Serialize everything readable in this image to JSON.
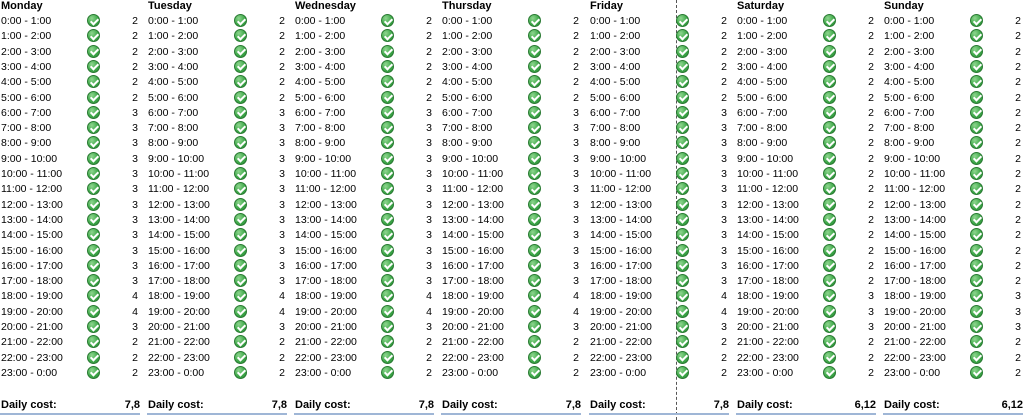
{
  "cost_label": "Daily cost:",
  "check_icon": "green-checkmark-icon",
  "days": [
    {
      "name": "Monday",
      "cost": "7,8",
      "values": [
        "2",
        "2",
        "2",
        "2",
        "2",
        "2",
        "3",
        "3",
        "3",
        "3",
        "3",
        "3",
        "3",
        "3",
        "3",
        "3",
        "3",
        "3",
        "4",
        "4",
        "3",
        "2",
        "2",
        "2"
      ]
    },
    {
      "name": "Tuesday",
      "cost": "7,8",
      "values": [
        "2",
        "2",
        "2",
        "2",
        "2",
        "2",
        "3",
        "3",
        "3",
        "3",
        "3",
        "3",
        "3",
        "3",
        "3",
        "3",
        "3",
        "3",
        "4",
        "4",
        "3",
        "2",
        "2",
        "2"
      ]
    },
    {
      "name": "Wednesday",
      "cost": "7,8",
      "values": [
        "2",
        "2",
        "2",
        "2",
        "2",
        "2",
        "3",
        "3",
        "3",
        "3",
        "3",
        "3",
        "3",
        "3",
        "3",
        "3",
        "3",
        "3",
        "4",
        "4",
        "3",
        "2",
        "2",
        "2"
      ]
    },
    {
      "name": "Thursday",
      "cost": "7,8",
      "values": [
        "2",
        "2",
        "2",
        "2",
        "2",
        "2",
        "3",
        "3",
        "3",
        "3",
        "3",
        "3",
        "3",
        "3",
        "3",
        "3",
        "3",
        "3",
        "4",
        "4",
        "3",
        "2",
        "2",
        "2"
      ]
    },
    {
      "name": "Friday",
      "cost": "7,8",
      "values": [
        "2",
        "2",
        "2",
        "2",
        "2",
        "2",
        "3",
        "3",
        "3",
        "3",
        "3",
        "3",
        "3",
        "3",
        "3",
        "3",
        "3",
        "3",
        "4",
        "4",
        "3",
        "2",
        "2",
        "2"
      ]
    },
    {
      "name": "Saturday",
      "cost": "6,12",
      "values": [
        "2",
        "2",
        "2",
        "2",
        "2",
        "2",
        "2",
        "2",
        "2",
        "2",
        "2",
        "2",
        "2",
        "2",
        "2",
        "2",
        "2",
        "2",
        "3",
        "3",
        "3",
        "2",
        "2",
        "2"
      ]
    },
    {
      "name": "Sunday",
      "cost": "6,12",
      "values": [
        "2",
        "2",
        "2",
        "2",
        "2",
        "2",
        "2",
        "2",
        "2",
        "2",
        "2",
        "2",
        "2",
        "2",
        "2",
        "2",
        "2",
        "2",
        "3",
        "3",
        "3",
        "2",
        "2",
        "2"
      ]
    }
  ],
  "slots": [
    "0:00 - 1:00",
    "1:00 - 2:00",
    "2:00 - 3:00",
    "3:00 - 4:00",
    "4:00 - 5:00",
    "5:00 - 6:00",
    "6:00 - 7:00",
    "7:00 - 8:00",
    "8:00 - 9:00",
    "9:00 - 10:00",
    "10:00 - 11:00",
    "11:00 - 12:00",
    "12:00 - 13:00",
    "13:00 - 14:00",
    "14:00 - 15:00",
    "15:00 - 16:00",
    "16:00 - 17:00",
    "17:00 - 18:00",
    "18:00 - 19:00",
    "19:00 - 20:00",
    "20:00 - 21:00",
    "21:00 - 22:00",
    "22:00 - 23:00",
    "23:00 - 0:00"
  ]
}
